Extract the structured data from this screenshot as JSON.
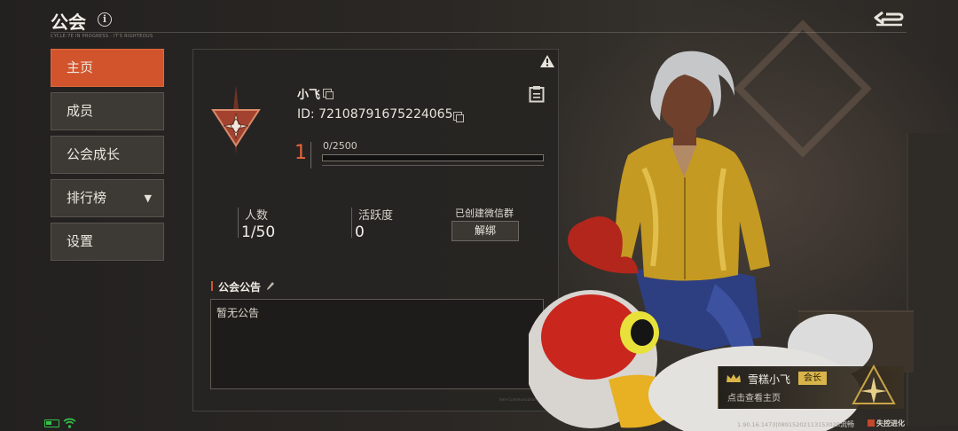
{
  "header": {
    "title": "公会",
    "subtitle": "CYCLE:7E IN PROGRESS · IT'S RIGHTEOUS",
    "info_icon": "info-icon",
    "back_icon": "return-arrow-icon"
  },
  "sidebar": {
    "items": [
      {
        "label": "主页",
        "active": true
      },
      {
        "label": "成员",
        "active": false
      },
      {
        "label": "公会成长",
        "active": false
      },
      {
        "label": "排行榜",
        "active": false,
        "has_dropdown": true
      },
      {
        "label": "设置",
        "active": false
      }
    ]
  },
  "guild": {
    "name": "小飞",
    "id_text": "ID: 72108791675224065",
    "level": "1",
    "exp_text": "0/2500",
    "exp_fraction": 0,
    "stats": {
      "members_label": "人数",
      "members_value": "1/50",
      "activity_label": "活跃度",
      "activity_value": "0"
    },
    "wechat_label": "已创建微信群",
    "unbind_label": "解绑",
    "notice_title": "公会公告",
    "notice_text": "暂无公告",
    "footnote": "Item Communication Channel"
  },
  "leader_card": {
    "name": "雪糕小飞",
    "badge": "会长",
    "link": "点击查看主页"
  },
  "status_bar": {
    "version": "1.90.16.1473|0891520211315302B",
    "quality": "流畅",
    "game_logo": "失控进化"
  },
  "colors": {
    "accent": "#d2542c",
    "level": "#e7643a",
    "badge_gold": "#d9b44a",
    "battery_green": "#34c24a"
  }
}
